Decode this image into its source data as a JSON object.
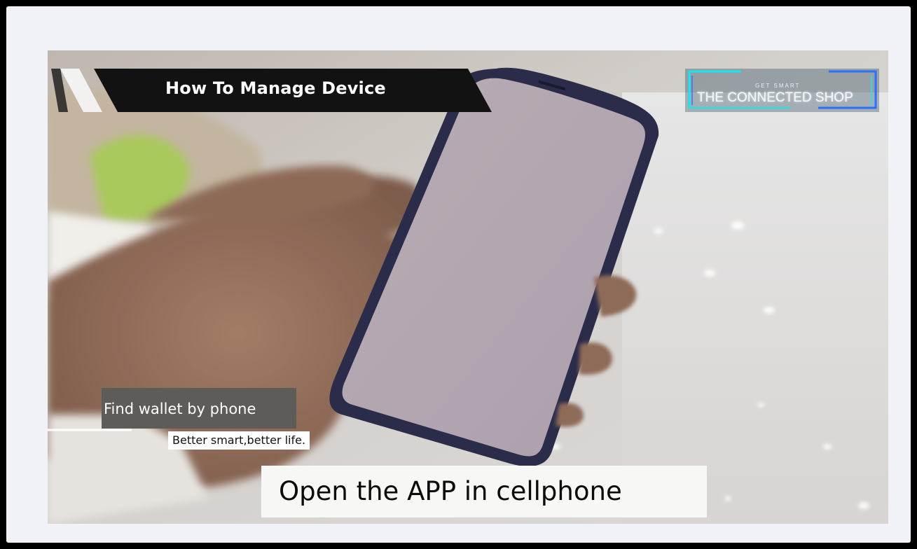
{
  "title_banner": {
    "text": "How To Manage Device"
  },
  "logo": {
    "tagline": "GET SMART",
    "name": "THE CONNECTED SHOP"
  },
  "captions": {
    "find": "Find wallet by phone",
    "slogan": "Better smart,better life.",
    "instruction": "Open the APP in cellphone"
  },
  "colors": {
    "frame_background": "#f1f2f7",
    "outer_border": "#000000",
    "banner": "#121212",
    "logo_neon": "#19e5f2",
    "logo_blue": "#2a70ff"
  }
}
